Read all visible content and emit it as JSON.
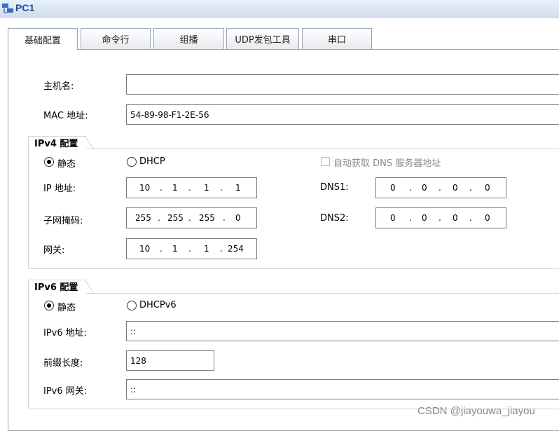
{
  "window": {
    "title": "PC1",
    "icon": "pc-network-icon"
  },
  "tabs": [
    {
      "label": "基础配置",
      "active": true
    },
    {
      "label": "命令行",
      "active": false
    },
    {
      "label": "组播",
      "active": false
    },
    {
      "label": "UDP发包工具",
      "active": false
    },
    {
      "label": "串口",
      "active": false
    }
  ],
  "host": {
    "hostname_label": "主机名:",
    "hostname_value": "",
    "mac_label": "MAC 地址:",
    "mac_value": "54-89-98-F1-2E-56"
  },
  "ipv4": {
    "section_title": "IPv4 配置",
    "static_label": "静态",
    "dhcp_label": "DHCP",
    "static_selected": true,
    "auto_dns_label": "自动获取 DNS 服务器地址",
    "ip_label": "IP 地址:",
    "ip": [
      "10",
      "1",
      "1",
      "1"
    ],
    "mask_label": "子网掩码:",
    "mask": [
      "255",
      "255",
      "255",
      "0"
    ],
    "gateway_label": "网关:",
    "gateway": [
      "10",
      "1",
      "1",
      "254"
    ],
    "dns1_label": "DNS1:",
    "dns1": [
      "0",
      "0",
      "0",
      "0"
    ],
    "dns2_label": "DNS2:",
    "dns2": [
      "0",
      "0",
      "0",
      "0"
    ]
  },
  "ipv6": {
    "section_title": "IPv6 配置",
    "static_label": "静态",
    "dhcp_label": "DHCPv6",
    "static_selected": true,
    "address_label": "IPv6 地址:",
    "address_value": "::",
    "prefix_label": "前缀长度:",
    "prefix_value": "128",
    "gateway_label": "IPv6 网关:",
    "gateway_value": "::"
  },
  "watermark": "CSDN @jiayouwa_jiayou"
}
